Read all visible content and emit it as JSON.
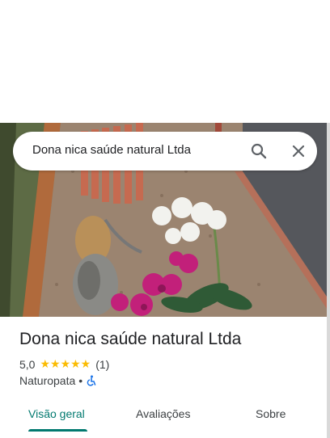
{
  "search": {
    "query": "Dona nica saúde natural Ltda"
  },
  "place": {
    "name": "Dona nica saúde natural Ltda",
    "rating": "5,0",
    "stars": "★★★★★",
    "stars_value": 5,
    "review_count": "(1)",
    "category": "Naturopata",
    "separator": "•",
    "accessibility_icon": "wheelchair-icon"
  },
  "tabs": [
    {
      "label": "Visão geral",
      "active": true
    },
    {
      "label": "Avaliações",
      "active": false
    },
    {
      "label": "Sobre",
      "active": false
    }
  ],
  "colors": {
    "accent": "#01796f",
    "star": "#fbbc04",
    "accessibility": "#1a73e8"
  }
}
